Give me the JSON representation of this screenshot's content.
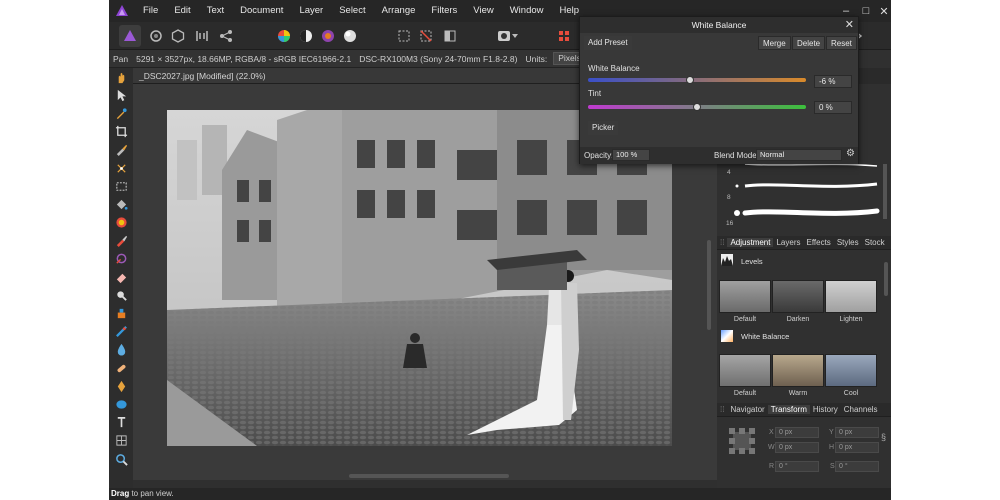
{
  "menu": [
    "File",
    "Edit",
    "Text",
    "Document",
    "Layer",
    "Select",
    "Arrange",
    "Filters",
    "View",
    "Window",
    "Help"
  ],
  "window_controls": {
    "minimize": "–",
    "maximize": "□",
    "close": "✕"
  },
  "context": {
    "tool": "Pan",
    "info": "5291 × 3527px, 18.66MP, RGBA/8 - sRGB IEC61966-2.1",
    "camera": "DSC-RX100M3 (Sony 24-70mm F1.8-2.8)",
    "units_label": "Units:",
    "units_value": "Pixels"
  },
  "document": {
    "tab_title": "_DSC2027.jpg [Modified] (22.0%)"
  },
  "status": {
    "bold": "Drag",
    "text": " to pan view."
  },
  "dialog": {
    "title": "White Balance",
    "close": "✕",
    "add_preset": "Add Preset",
    "merge": "Merge",
    "delete": "Delete",
    "reset": "Reset",
    "wb_label": "White Balance",
    "wb_value": "-6 %",
    "wb_level": 0.47,
    "tint_label": "Tint",
    "tint_value": "0 %",
    "tint_level": 0.5,
    "picker": "Picker",
    "opacity_label": "Opacity:",
    "opacity_value": "100 %",
    "blend_label": "Blend Mode:",
    "blend_value": "Normal"
  },
  "brush_sizes": [
    "4",
    "8",
    "16"
  ],
  "studio_tabs_1": {
    "tabs": [
      "Adjustment",
      "Layers",
      "Effects",
      "Styles",
      "Stock"
    ],
    "selected": "Adjustment"
  },
  "adjustments": {
    "levels": {
      "title": "Levels",
      "presets": [
        "Default",
        "Darken",
        "Lighten"
      ]
    },
    "white_balance": {
      "title": "White Balance",
      "presets": [
        "Default",
        "Warm",
        "Cool"
      ]
    }
  },
  "studio_tabs_2": {
    "tabs": [
      "Navigator",
      "Transform",
      "History",
      "Channels"
    ],
    "selected": "Transform"
  },
  "transform": {
    "x_label": "X",
    "y_label": "Y",
    "w_label": "W",
    "h_label": "H",
    "r_label": "R",
    "s_label": "S",
    "x": "0 px",
    "y": "0 px",
    "w": "0 px",
    "h": "0 px",
    "r": "0 °",
    "s": "0 °"
  },
  "colors": {
    "accent": "#9b59d6",
    "wb_gradient": [
      "#3a4fc8",
      "#d98a2a"
    ],
    "tint_gradient": [
      "#c03ad0",
      "#3cc03c"
    ]
  }
}
